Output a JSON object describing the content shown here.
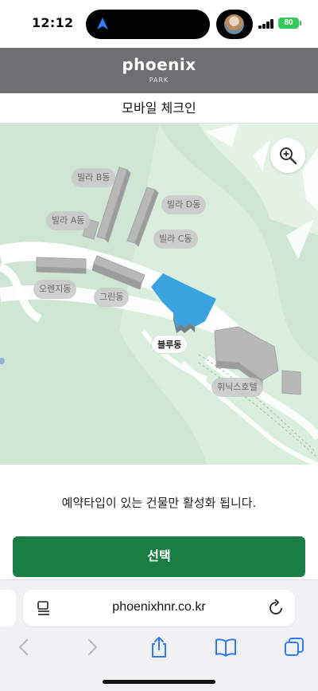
{
  "status": {
    "time": "12:12",
    "battery": "80"
  },
  "header": {
    "brand": "phoenix",
    "brand_sub": "PARK",
    "page_title": "모바일 체크인"
  },
  "map": {
    "buildings": [
      {
        "key": "villa-b",
        "label": "빌라 B동",
        "active": false
      },
      {
        "key": "villa-a",
        "label": "빌라 A동",
        "active": false
      },
      {
        "key": "villa-d",
        "label": "빌라 D동",
        "active": false
      },
      {
        "key": "villa-c",
        "label": "빌라 C동",
        "active": false
      },
      {
        "key": "orange",
        "label": "오렌지동",
        "active": false
      },
      {
        "key": "green",
        "label": "그린동",
        "active": false
      },
      {
        "key": "blue",
        "label": "블루동",
        "active": true
      },
      {
        "key": "phoenix-hotel",
        "label": "휘닉스호텔",
        "active": false
      }
    ],
    "active_color": "#3aa3e0",
    "zoom_icon": "zoom-in-icon"
  },
  "notice": "예약타입이 있는 건물만 활성화 됩니다.",
  "action": {
    "select_label": "선택",
    "color": "#1a7d44"
  },
  "browser": {
    "url": "phoenixhnr.co.kr",
    "toolbar": [
      "back-icon",
      "forward-icon",
      "share-icon",
      "bookmarks-icon",
      "tabs-icon"
    ]
  }
}
